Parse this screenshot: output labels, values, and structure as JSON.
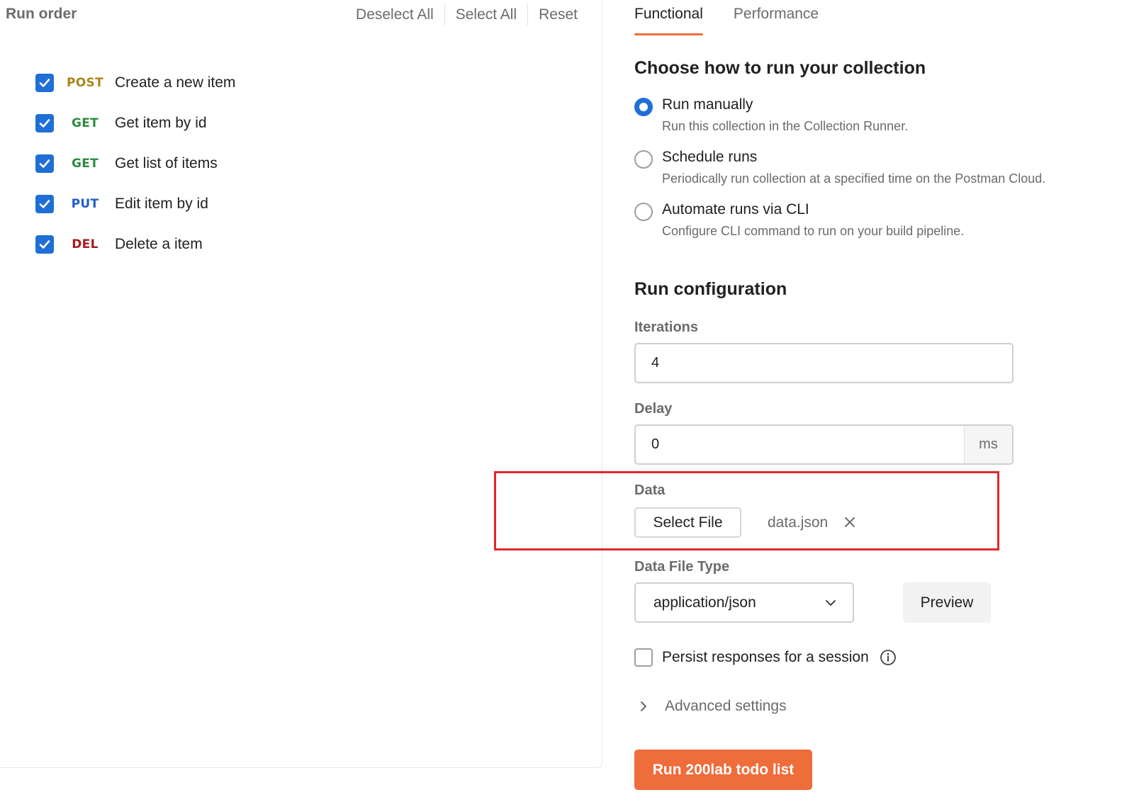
{
  "left": {
    "title": "Run order",
    "actions": {
      "deselect_all": "Deselect All",
      "select_all": "Select All",
      "reset": "Reset"
    },
    "requests": [
      {
        "method": "POST",
        "name": "Create a new item",
        "checked": true,
        "method_color": "#a8861a"
      },
      {
        "method": "GET",
        "name": "Get item by id",
        "checked": true,
        "method_color": "#2d8a3e"
      },
      {
        "method": "GET",
        "name": "Get list of items",
        "checked": true,
        "method_color": "#2d8a3e"
      },
      {
        "method": "PUT",
        "name": "Edit item by id",
        "checked": true,
        "method_color": "#1f5fc6"
      },
      {
        "method": "DEL",
        "name": "Delete a item",
        "checked": true,
        "method_color": "#a61d1d"
      }
    ]
  },
  "right": {
    "tabs": [
      {
        "label": "Functional",
        "active": true
      },
      {
        "label": "Performance",
        "active": false
      }
    ],
    "run_mode": {
      "heading": "Choose how to run your collection",
      "options": [
        {
          "label": "Run manually",
          "description": "Run this collection in the Collection Runner.",
          "selected": true
        },
        {
          "label": "Schedule runs",
          "description": "Periodically run collection at a specified time on the Postman Cloud.",
          "selected": false
        },
        {
          "label": "Automate runs via CLI",
          "description": "Configure CLI command to run on your build pipeline.",
          "selected": false
        }
      ]
    },
    "config": {
      "heading": "Run configuration",
      "iterations_label": "Iterations",
      "iterations_value": "4",
      "delay_label": "Delay",
      "delay_value": "0",
      "delay_unit": "ms",
      "data_label": "Data",
      "select_file_label": "Select File",
      "file_name": "data.json",
      "data_file_type_label": "Data File Type",
      "data_file_type_value": "application/json",
      "preview_label": "Preview",
      "persist_label": "Persist responses for a session",
      "persist_checked": false,
      "advanced_label": "Advanced settings",
      "run_button_label": "Run 200lab todo list"
    }
  },
  "colors": {
    "accent": "#ef6c3b",
    "checkbox_blue": "#1f6fd6",
    "highlight_red": "#e0292a"
  }
}
